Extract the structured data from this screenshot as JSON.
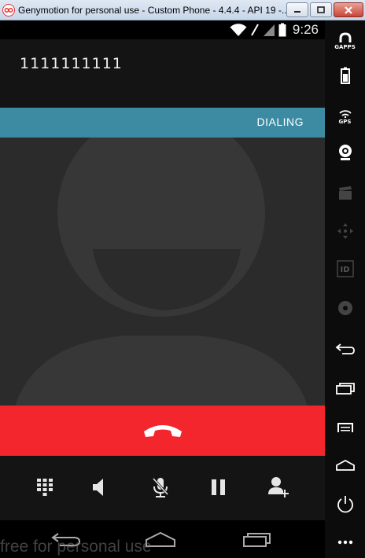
{
  "window": {
    "title": "Genymotion for personal use - Custom Phone - 4.4.4 - API 19 -...",
    "app_icon": "genymotion-icon"
  },
  "statusbar": {
    "time": "9:26",
    "icons": [
      "wifi-icon",
      "signal-off-icon",
      "signal-icon",
      "battery-icon"
    ]
  },
  "call": {
    "number": "1111111111",
    "state": "DIALING",
    "state_color": "#3d8ba3",
    "end_call_color": "#f2262c"
  },
  "controls": [
    "dialpad-icon",
    "speaker-icon",
    "mute-icon",
    "hold-icon",
    "add-call-icon"
  ],
  "navbar": [
    "back-icon",
    "home-icon",
    "recents-icon"
  ],
  "watermark": "free for personal use",
  "sidebar": {
    "items": [
      {
        "icon": "gapps-icon",
        "label": "GAPPS"
      },
      {
        "icon": "battery-icon",
        "label": ""
      },
      {
        "icon": "gps-icon",
        "label": "GPS"
      },
      {
        "icon": "webcam-icon",
        "label": ""
      },
      {
        "icon": "clapperboard-icon",
        "label": ""
      },
      {
        "icon": "dpad-icon",
        "label": ""
      },
      {
        "icon": "id-icon",
        "label": "ID"
      },
      {
        "icon": "disk-icon",
        "label": ""
      },
      {
        "icon": "back-icon",
        "label": ""
      },
      {
        "icon": "recents-icon",
        "label": ""
      },
      {
        "icon": "menu-icon",
        "label": ""
      },
      {
        "icon": "home-icon",
        "label": ""
      },
      {
        "icon": "power-icon",
        "label": ""
      },
      {
        "icon": "more-icon",
        "label": ""
      }
    ]
  }
}
